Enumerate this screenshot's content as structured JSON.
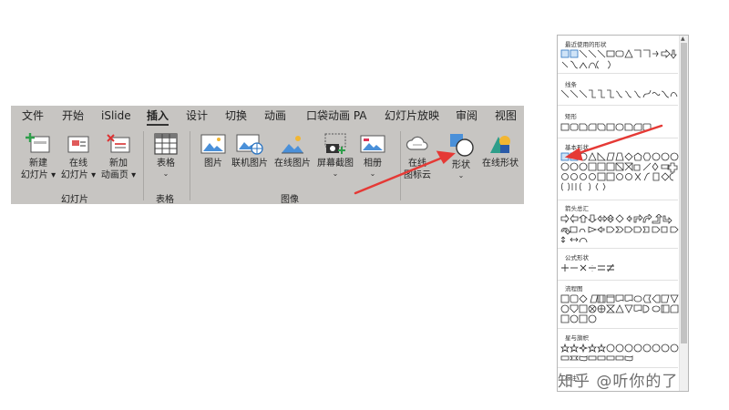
{
  "ribbon": {
    "tabs": [
      "文件",
      "开始",
      "iSlide",
      "插入",
      "设计",
      "切换",
      "动画",
      "口袋动画 PA",
      "幻灯片放映",
      "审阅",
      "视图"
    ],
    "active_tab": "插入",
    "commands": {
      "new_slide": [
        "新建",
        "幻灯片 ▾"
      ],
      "online_slide": [
        "在线",
        "幻灯片 ▾"
      ],
      "new_anim_page": [
        "新加",
        "动画页 ▾"
      ],
      "table": "表格",
      "picture": "图片",
      "online_picture_link": "联机图片",
      "online_picture": "在线图片",
      "screenshot": "屏幕截图",
      "album": "相册",
      "online_icon": [
        "在线",
        "图标云"
      ],
      "shapes": "形状",
      "online_shapes": "在线形状"
    },
    "groups": {
      "slides": "幻灯片",
      "tables": "表格",
      "images": "图像"
    }
  },
  "shapes_panel": {
    "sections": {
      "recent": "最近使用的形状",
      "lines": "线条",
      "rect": "矩形",
      "basic": "基本形状",
      "arrows": "箭头总汇",
      "equation": "公式形状",
      "flowchart": "流程图",
      "stars": "星与旗帜",
      "callouts": "标注"
    }
  },
  "watermark": "知乎 @听你的了",
  "colors": {
    "ribbon_bg": "#c7c5c2",
    "accent_blue": "#4a90d9",
    "arrow_red": "#e53935"
  }
}
